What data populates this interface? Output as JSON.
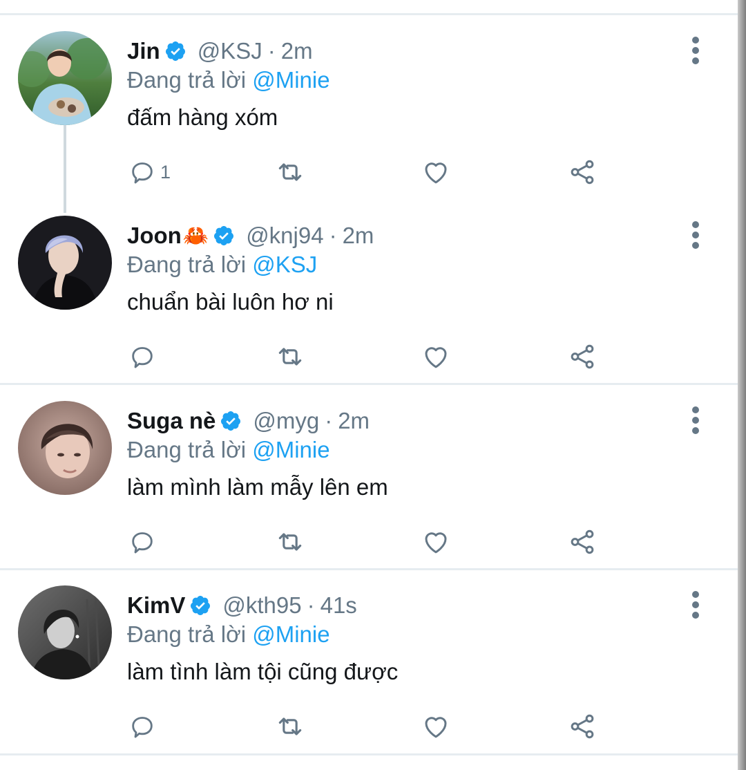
{
  "tweets": [
    {
      "name": "Jin",
      "emoji": "",
      "handle": "@KSJ",
      "separator": "·",
      "time": "2m",
      "reply_prefix": "Đang trả lời",
      "reply_to": "@Minie",
      "text": "đấm hàng xóm",
      "reply_count": "1",
      "verified": true
    },
    {
      "name": "Joon",
      "emoji": "🦀",
      "handle": "@knj94",
      "separator": "·",
      "time": "2m",
      "reply_prefix": "Đang trả lời",
      "reply_to": "@KSJ",
      "text": "chuẩn bài luôn hơ ni",
      "reply_count": "",
      "verified": true
    },
    {
      "name": "Suga nè",
      "emoji": "",
      "handle": "@myg",
      "separator": "·",
      "time": "2m",
      "reply_prefix": "Đang trả lời",
      "reply_to": "@Minie",
      "text": "làm mình làm mẫy lên em",
      "reply_count": "",
      "verified": true
    },
    {
      "name": "KimV",
      "emoji": "",
      "handle": "@kth95",
      "separator": "·",
      "time": "41s",
      "reply_prefix": "Đang trả lời",
      "reply_to": "@Minie",
      "text": "làm tình làm tội cũng được",
      "reply_count": "",
      "verified": true
    }
  ],
  "icons": {
    "reply": "comment-bubble-icon",
    "retweet": "retweet-icon",
    "like": "heart-icon",
    "share": "share-icon",
    "more": "more-vertical-icon",
    "verified": "verified-badge-icon"
  },
  "colors": {
    "link": "#1da1f2",
    "secondary_text": "#657786",
    "primary_text": "#14171a",
    "verified": "#1da1f2",
    "divider": "#e6ecf0"
  }
}
